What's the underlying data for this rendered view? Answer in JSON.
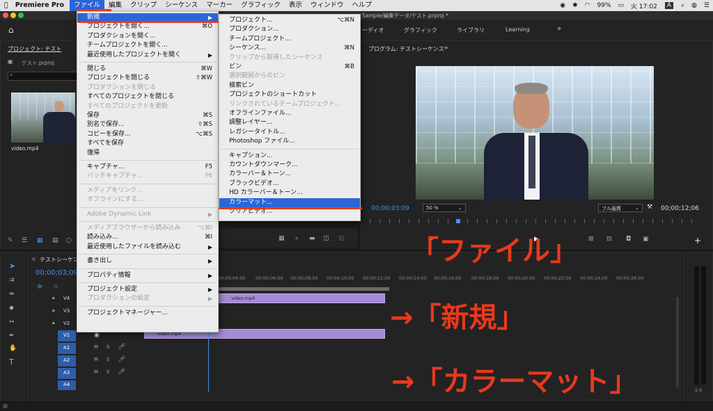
{
  "menubar": {
    "app": "Premiere Pro",
    "items": [
      "ファイル",
      "編集",
      "クリップ",
      "シーケンス",
      "マーカー",
      "グラフィック",
      "表示",
      "ウィンドウ",
      "ヘルプ"
    ],
    "status": {
      "battery": "99%",
      "clock": "火 17:02",
      "input": "A"
    }
  },
  "titlebar": {
    "path": "Sample/編集データ/テスト.prproj *"
  },
  "workspace": {
    "tabs": [
      "ーディオ",
      "グラフィック",
      "ライブラリ",
      "Learning"
    ],
    "more": "»"
  },
  "project": {
    "title": "プロジェクト: テスト",
    "file": "テスト.prproj",
    "clip_name": "video.mp4"
  },
  "program": {
    "title": "プログラム: テストシーケンス",
    "timecode": "00;00;03;09",
    "zoom": "50 %",
    "quality": "フル画質",
    "duration": "00;00;12;06"
  },
  "timeline": {
    "tab": "テストシーケン",
    "timecode": "00;00;03;09",
    "ruler": [
      "00;00",
      "00;00;04;00",
      "00;00;06;00",
      "00;00;08;00",
      "00;00;10;00",
      "00;00;12;00",
      "00;00;14;00",
      "00;00;16;00",
      "00;00;18;00",
      "00;00;20;00",
      "00;00;22;00",
      "00;00;24;00",
      "00;00;26;00"
    ],
    "tracks": [
      "V4",
      "V3",
      "V2",
      "V1",
      "A1",
      "A2",
      "A3",
      "A4"
    ],
    "clip_label": "video.mp4",
    "meter": "S S"
  },
  "file_menu": {
    "items": [
      {
        "label": "新規",
        "shortcut": "",
        "arrow": "▶",
        "state": "hl"
      },
      {
        "label": "プロジェクトを開く...",
        "shortcut": "⌘O",
        "state": ""
      },
      {
        "label": "プロダクションを開く...",
        "shortcut": "",
        "state": ""
      },
      {
        "label": "チームプロジェクトを開く...",
        "shortcut": "",
        "state": ""
      },
      {
        "label": "最近使用したプロジェクトを開く",
        "shortcut": "",
        "arrow": "▶",
        "state": ""
      },
      {
        "sep": true
      },
      {
        "label": "閉じる",
        "shortcut": "⌘W",
        "state": ""
      },
      {
        "label": "プロジェクトを閉じる",
        "shortcut": "⇧⌘W",
        "state": ""
      },
      {
        "label": "プロダクションを閉じる",
        "shortcut": "",
        "state": "dis"
      },
      {
        "label": "すべてのプロジェクトを閉じる",
        "shortcut": "",
        "state": ""
      },
      {
        "label": "すべてのプロジェクトを更新",
        "shortcut": "",
        "state": "dis"
      },
      {
        "label": "保存",
        "shortcut": "⌘S",
        "state": ""
      },
      {
        "label": "別名で保存...",
        "shortcut": "⇧⌘S",
        "state": ""
      },
      {
        "label": "コピーを保存...",
        "shortcut": "⌥⌘S",
        "state": ""
      },
      {
        "label": "すべてを保存",
        "shortcut": "",
        "state": ""
      },
      {
        "label": "復帰",
        "shortcut": "",
        "state": ""
      },
      {
        "sep": true
      },
      {
        "label": "キャプチャ...",
        "shortcut": "F5",
        "state": ""
      },
      {
        "label": "バッチキャプチャ...",
        "shortcut": "F6",
        "state": "dis"
      },
      {
        "sep": true
      },
      {
        "label": "メディアをリンク...",
        "shortcut": "",
        "state": "dis"
      },
      {
        "label": "オフラインにする...",
        "shortcut": "",
        "state": "dis"
      },
      {
        "sep": true
      },
      {
        "label": "Adobe Dynamic Link",
        "shortcut": "",
        "arrow": "▶",
        "state": "dis"
      },
      {
        "sep": true
      },
      {
        "label": "メディアブラウザーから読み込み",
        "shortcut": "⌥⌘I",
        "state": "dis"
      },
      {
        "label": "読み込み...",
        "shortcut": "⌘I",
        "state": ""
      },
      {
        "label": "最近使用したファイルを読み込む",
        "shortcut": "",
        "arrow": "▶",
        "state": ""
      },
      {
        "sep": true
      },
      {
        "label": "書き出し",
        "shortcut": "",
        "arrow": "▶",
        "state": ""
      },
      {
        "sep": true
      },
      {
        "label": "プロパティ情報",
        "shortcut": "",
        "arrow": "▶",
        "state": ""
      },
      {
        "sep": true
      },
      {
        "label": "プロジェクト設定",
        "shortcut": "",
        "arrow": "▶",
        "state": ""
      },
      {
        "label": "プロダクションの設定",
        "shortcut": "",
        "arrow": "▶",
        "state": "dis"
      },
      {
        "sep": true
      },
      {
        "label": "プロジェクトマネージャー...",
        "shortcut": "",
        "state": ""
      }
    ]
  },
  "new_menu": {
    "items": [
      {
        "label": "プロジェクト...",
        "shortcut": "⌥⌘N",
        "state": ""
      },
      {
        "label": "プロダクション...",
        "shortcut": "",
        "state": ""
      },
      {
        "label": "チームプロジェクト...",
        "shortcut": "",
        "state": ""
      },
      {
        "label": "シーケンス...",
        "shortcut": "⌘N",
        "state": ""
      },
      {
        "label": "クリップから取得したシーケンス",
        "shortcut": "",
        "state": "dis"
      },
      {
        "label": "ビン",
        "shortcut": "⌘B",
        "state": ""
      },
      {
        "label": "選択範囲からのビン",
        "shortcut": "",
        "state": "dis"
      },
      {
        "label": "検索ビン",
        "shortcut": "",
        "state": ""
      },
      {
        "label": "プロジェクトのショートカット",
        "shortcut": "",
        "state": ""
      },
      {
        "label": "リンクされているチームプロジェクト...",
        "shortcut": "",
        "state": "dis"
      },
      {
        "label": "オフラインファイル...",
        "shortcut": "",
        "state": ""
      },
      {
        "label": "調整レイヤー...",
        "shortcut": "",
        "state": ""
      },
      {
        "label": "レガシータイトル...",
        "shortcut": "",
        "state": ""
      },
      {
        "label": "Photoshop ファイル...",
        "shortcut": "",
        "state": ""
      },
      {
        "sep": true
      },
      {
        "label": "キャプション...",
        "shortcut": "",
        "state": ""
      },
      {
        "label": "カウントダウンマーク...",
        "shortcut": "",
        "state": ""
      },
      {
        "label": "カラーバー＆トーン...",
        "shortcut": "",
        "state": ""
      },
      {
        "label": "ブラックビデオ...",
        "shortcut": "",
        "state": ""
      },
      {
        "label": "HD カラーバー＆トーン...",
        "shortcut": "",
        "state": ""
      },
      {
        "label": "カラーマット...",
        "shortcut": "",
        "state": "hl"
      },
      {
        "label": "クリアビデオ...",
        "shortcut": "",
        "state": ""
      }
    ]
  },
  "annotations": {
    "a1": "「ファイル」",
    "a2": "→「新規」",
    "a3": "→「カラーマット」"
  },
  "colors": {
    "accent": "#2b66d9",
    "annotation": "#e8391d",
    "clip": "#a58ad6"
  }
}
